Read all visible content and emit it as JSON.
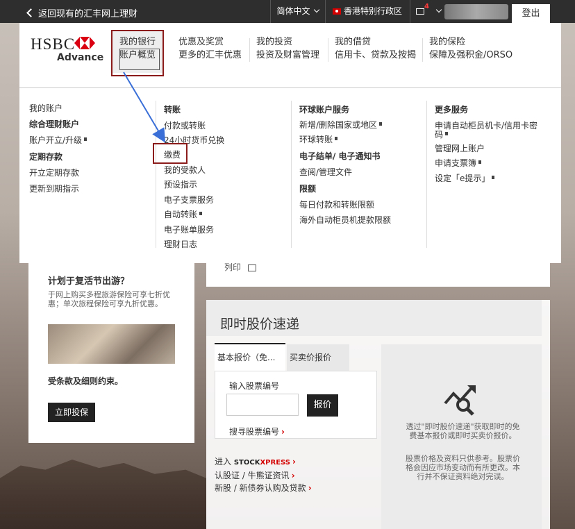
{
  "topbar": {
    "back_label": "返回现有的汇丰网上理财",
    "language": "简体中文",
    "region": "香港特别行政区",
    "mail_count": "4",
    "logout_label": "登出"
  },
  "logo": {
    "brand": "HSBC",
    "sub": "Advance"
  },
  "nav": [
    {
      "line1": "我的银行",
      "line2": "账户概览"
    },
    {
      "line1": "优惠及奖赏",
      "line2": "更多的汇丰优惠"
    },
    {
      "line1": "我的投资",
      "line2": "投资及财富管理"
    },
    {
      "line1": "我的借贷",
      "line2": "信用卡、贷款及按揭"
    },
    {
      "line1": "我的保险",
      "line2": "保障及强积金/ORSO"
    }
  ],
  "menu": {
    "col1": [
      "我的账户",
      "综合理财账户",
      "账户开立/升级",
      "定期存款",
      "开立定期存款",
      "更新到期指示"
    ],
    "col2": [
      "转账",
      "付款或转账",
      "24小时货币兑换",
      "缴费",
      "我的受款人",
      "预设指示",
      "电子支票服务",
      "自动转账",
      "电子账单服务",
      "理财日志"
    ],
    "col3": [
      "环球账户服务",
      "新增/删除国家或地区",
      "环球转账",
      "电子结单/ 电子通知书",
      "查阅/管理文件",
      "限额",
      "每日付款和转账限额",
      "海外自动柜员机提款限额"
    ],
    "col4": [
      "更多服务",
      "申请自动柜员机卡/信用卡密",
      "码",
      "管理网上账户",
      "申请支票簿",
      "设定「e提示」"
    ]
  },
  "promo": {
    "title": "计划于复活节出游？",
    "desc": "于网上购买多程旅游保险可享七折优惠；单次旅程保险可享九折优惠。",
    "terms": "受条款及细则约束。",
    "button": "立即投保"
  },
  "print_label": "列印",
  "stock": {
    "title": "即时股价速递",
    "tab1": "基本报价（免...",
    "tab2": "买卖价报价",
    "input_label": "输入股票编号",
    "quote_button": "报价",
    "search_link": "搜寻股票编号",
    "stockx_prefix": "进入",
    "stockx_brand_a": "STOCK",
    "stockx_brand_b": "XPRESS",
    "link2": "认股证 / 牛熊证资讯",
    "link3": "新股 / 新债券认购及贷款",
    "info1": "透过\"即时股价速递\"获取即时的免费基本报价或即时买卖价报价。",
    "info2": "股票价格及资料只供参考。股票价格会因应市场变动而有所更改。本行并不保证资料绝对完误。"
  }
}
